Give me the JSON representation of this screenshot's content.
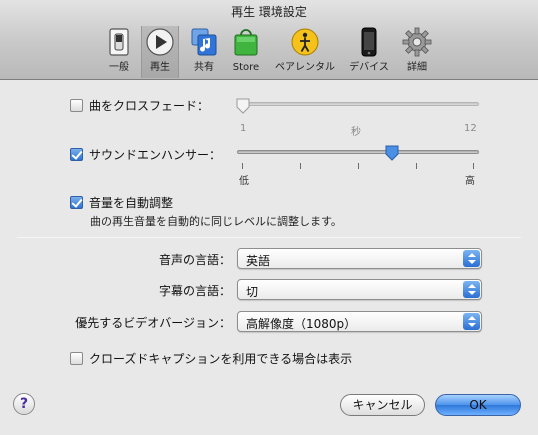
{
  "window": {
    "title": "再生 環境設定"
  },
  "toolbar": {
    "items": [
      {
        "label": "一般",
        "icon": "general-switch-icon"
      },
      {
        "label": "再生",
        "icon": "playback-icon",
        "selected": true
      },
      {
        "label": "共有",
        "icon": "sharing-icon"
      },
      {
        "label": "Store",
        "icon": "store-bag-icon"
      },
      {
        "label": "ペアレンタル",
        "icon": "parental-icon"
      },
      {
        "label": "デバイス",
        "icon": "device-icon"
      },
      {
        "label": "詳細",
        "icon": "gear-icon"
      }
    ]
  },
  "crossfade": {
    "label": "曲をクロスフェード：",
    "checked": false,
    "min_label": "1",
    "unit_label": "秒",
    "max_label": "12",
    "value_fraction": 0.0
  },
  "sound_enhancer": {
    "label": "サウンドエンハンサー：",
    "checked": true,
    "low_label": "低",
    "high_label": "高",
    "value_fraction": 0.6
  },
  "sound_check": {
    "label": "音量を自動調整",
    "checked": true,
    "description": "曲の再生音量を自動的に同じレベルに調整します。"
  },
  "audio_language": {
    "label": "音声の言語：",
    "value": "英語"
  },
  "subtitle_language": {
    "label": "字幕の言語：",
    "value": "切"
  },
  "preferred_video": {
    "label": "優先するビデオバージョン：",
    "value": "高解像度（1080p）"
  },
  "closed_captions": {
    "label": "クローズドキャプションを利用できる場合は表示",
    "checked": false
  },
  "buttons": {
    "help": "?",
    "cancel": "キャンセル",
    "ok": "OK"
  },
  "colors": {
    "accent": "#2f73d2"
  }
}
